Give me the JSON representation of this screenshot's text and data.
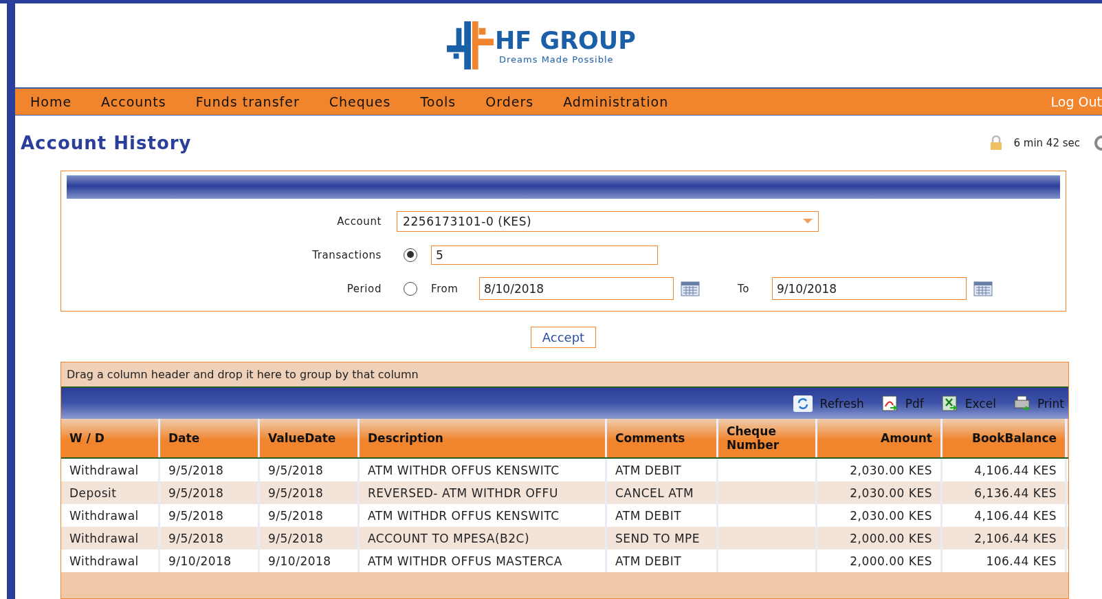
{
  "logo": {
    "name": "HF GROUP",
    "tagline": "Dreams Made Possible"
  },
  "nav": {
    "items": [
      "Home",
      "Accounts",
      "Funds transfer",
      "Cheques",
      "Tools",
      "Orders",
      "Administration"
    ],
    "logout": "Log Out"
  },
  "page_title": "Account History",
  "session": {
    "timer": "6 min 42 sec"
  },
  "form": {
    "account_label": "Account",
    "account_value": "2256173101-0 (KES)",
    "transactions": {
      "label": "Transactions",
      "selected": true,
      "value": "5"
    },
    "period": {
      "label": "Period",
      "selected": false,
      "from_label": "From",
      "from": "8/10/2018",
      "to_label": "To",
      "to": "9/10/2018"
    }
  },
  "accept": "Accept",
  "grid": {
    "group_hint": "Drag a column header and drop it here to group by that column",
    "toolbar": [
      {
        "kind": "refresh",
        "label": "Refresh"
      },
      {
        "kind": "pdf",
        "label": "Pdf"
      },
      {
        "kind": "excel",
        "label": "Excel"
      },
      {
        "kind": "print",
        "label": "Print"
      }
    ],
    "columns": [
      "W / D",
      "Date",
      "ValueDate",
      "Description",
      "Comments",
      "Cheque Number",
      "Amount",
      "BookBalance"
    ],
    "rows": [
      [
        "Withdrawal",
        "9/5/2018",
        "9/5/2018",
        "ATM WITHDR OFFUS KENSWITC",
        "ATM DEBIT",
        "",
        "2,030.00 KES",
        "4,106.44 KES"
      ],
      [
        "Deposit",
        "9/5/2018",
        "9/5/2018",
        "REVERSED- ATM WITHDR OFFU",
        "CANCEL ATM",
        "",
        "2,030.00 KES",
        "6,136.44 KES"
      ],
      [
        "Withdrawal",
        "9/5/2018",
        "9/5/2018",
        "ATM WITHDR OFFUS KENSWITC",
        "ATM DEBIT",
        "",
        "2,030.00 KES",
        "4,106.44 KES"
      ],
      [
        "Withdrawal",
        "9/5/2018",
        "9/5/2018",
        "ACCOUNT TO MPESA(B2C)",
        "SEND TO MPE",
        "",
        "2,000.00 KES",
        "2,106.44 KES"
      ],
      [
        "Withdrawal",
        "9/10/2018",
        "9/10/2018",
        "ATM WITHDR OFFUS MASTERCA",
        "ATM DEBIT",
        "",
        "2,000.00 KES",
        "106.44 KES"
      ]
    ]
  }
}
